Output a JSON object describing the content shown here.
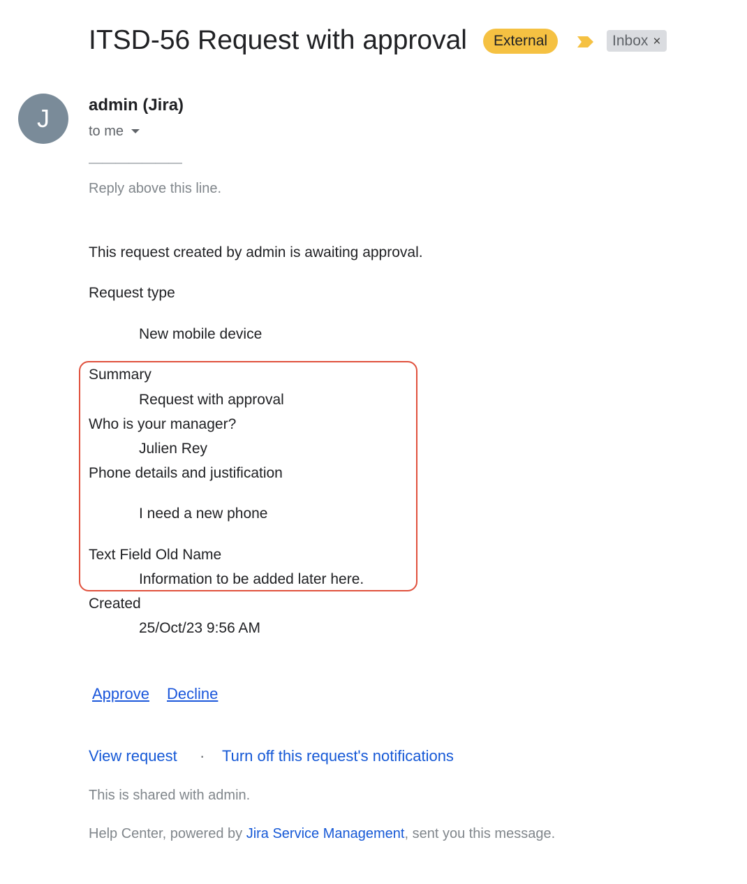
{
  "colors": {
    "external_badge": "#f5c142",
    "importance_marker": "#f5c142",
    "inbox_badge": "#dadce0",
    "avatar": "#7a8b99",
    "link": "#1558d6",
    "highlight_box": "#e0503c"
  },
  "header": {
    "subject": "ITSD-56 Request with approval",
    "external_label": "External",
    "importance_icon": "importance-marker-icon",
    "inbox_label": "Inbox",
    "inbox_remove_symbol": "×"
  },
  "sender": {
    "avatar_initial": "J",
    "name": "admin (Jira)",
    "recipient": "to me"
  },
  "body": {
    "separator": "———————",
    "reply_line": "Reply above this line.",
    "intro": "This request created by admin is awaiting approval.",
    "fields": [
      {
        "label": "Request type",
        "value": "New mobile device"
      },
      {
        "label": "Summary",
        "value": "Request with approval"
      },
      {
        "label": "Who is your manager?",
        "value": "Julien Rey"
      },
      {
        "label": "Phone details and justification",
        "value": "I need a new phone"
      },
      {
        "label": "Text Field Old Name",
        "value": "Information to be added later here."
      },
      {
        "label": "Created",
        "value": "25/Oct/23 9:56 AM"
      }
    ]
  },
  "actions": {
    "approve": "Approve",
    "decline": "Decline"
  },
  "footer": {
    "view_request": "View request",
    "separator_dot": "·",
    "turn_off": "Turn off this request's notifications",
    "shared": "This is shared with admin.",
    "powered_prefix": "Help Center, powered by ",
    "powered_link": "Jira Service Management",
    "powered_suffix": ", sent you this message."
  }
}
